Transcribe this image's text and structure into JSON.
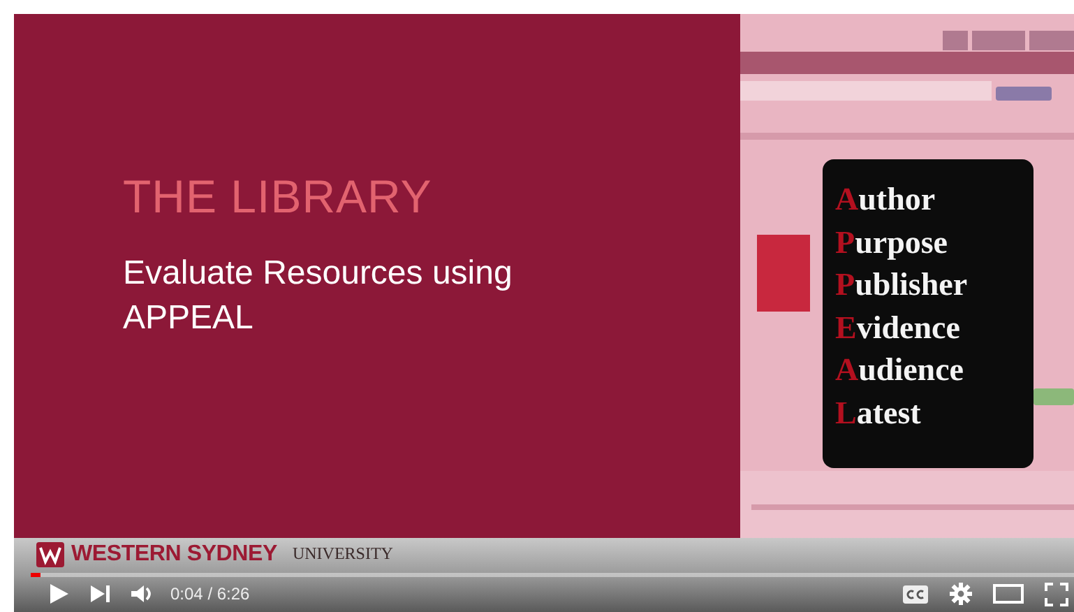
{
  "slide": {
    "title": "THE LIBRARY",
    "subtitle": "Evaluate Resources using APPEAL"
  },
  "appeal": {
    "words": [
      {
        "initial": "A",
        "rest": "uthor"
      },
      {
        "initial": "P",
        "rest": "urpose"
      },
      {
        "initial": "P",
        "rest": "ublisher"
      },
      {
        "initial": "E",
        "rest": "vidence"
      },
      {
        "initial": "A",
        "rest": "udience"
      },
      {
        "initial": "L",
        "rest": "atest"
      }
    ]
  },
  "logo": {
    "name": "WESTERN SYDNEY",
    "subname": "UNIVERSITY"
  },
  "player": {
    "level": 0.01,
    "playing": false,
    "time": "0:04 / 6:26"
  }
}
